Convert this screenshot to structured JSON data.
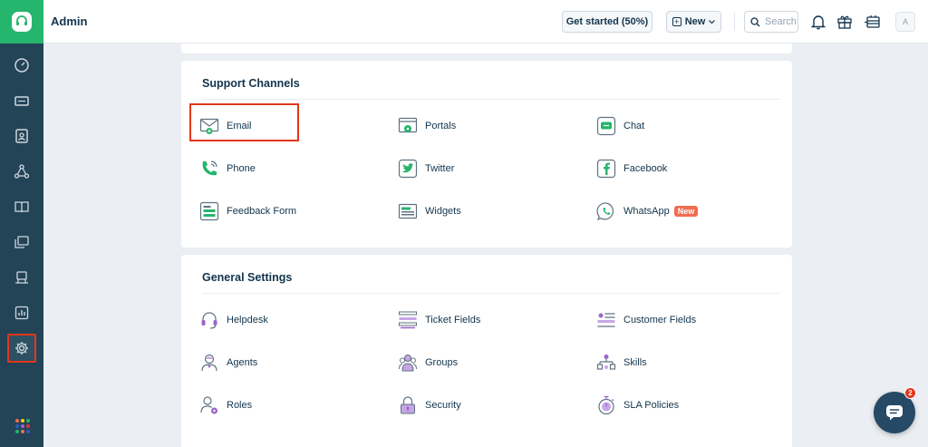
{
  "header": {
    "title": "Admin",
    "get_started": "Get started (50%)",
    "new_label": "New",
    "search_placeholder": "Search",
    "avatar_initial": "A"
  },
  "support_channels": {
    "title": "Support Channels",
    "items": [
      {
        "label": "Email",
        "icon": "email-icon"
      },
      {
        "label": "Portals",
        "icon": "portals-icon"
      },
      {
        "label": "Chat",
        "icon": "chat-icon"
      },
      {
        "label": "Phone",
        "icon": "phone-icon"
      },
      {
        "label": "Twitter",
        "icon": "twitter-icon"
      },
      {
        "label": "Facebook",
        "icon": "facebook-icon"
      },
      {
        "label": "Feedback Form",
        "icon": "feedback-form-icon"
      },
      {
        "label": "Widgets",
        "icon": "widgets-icon"
      },
      {
        "label": "WhatsApp",
        "icon": "whatsapp-icon",
        "badge": "New"
      }
    ]
  },
  "general_settings": {
    "title": "General Settings",
    "items": [
      {
        "label": "Helpdesk",
        "icon": "headset-icon"
      },
      {
        "label": "Ticket Fields",
        "icon": "ticket-fields-icon"
      },
      {
        "label": "Customer Fields",
        "icon": "customer-fields-icon"
      },
      {
        "label": "Agents",
        "icon": "agent-icon"
      },
      {
        "label": "Groups",
        "icon": "groups-icon"
      },
      {
        "label": "Skills",
        "icon": "skills-icon"
      },
      {
        "label": "Roles",
        "icon": "roles-icon"
      },
      {
        "label": "Security",
        "icon": "lock-icon"
      },
      {
        "label": "SLA Policies",
        "icon": "stopwatch-icon"
      }
    ]
  },
  "chat_widget": {
    "badge_count": "2"
  },
  "colors": {
    "sidebar": "#234457",
    "brand_green": "#26b56c",
    "highlight_red": "#e3361b",
    "channel_green": "#26b56c",
    "settings_purple": "#9b65c9"
  }
}
